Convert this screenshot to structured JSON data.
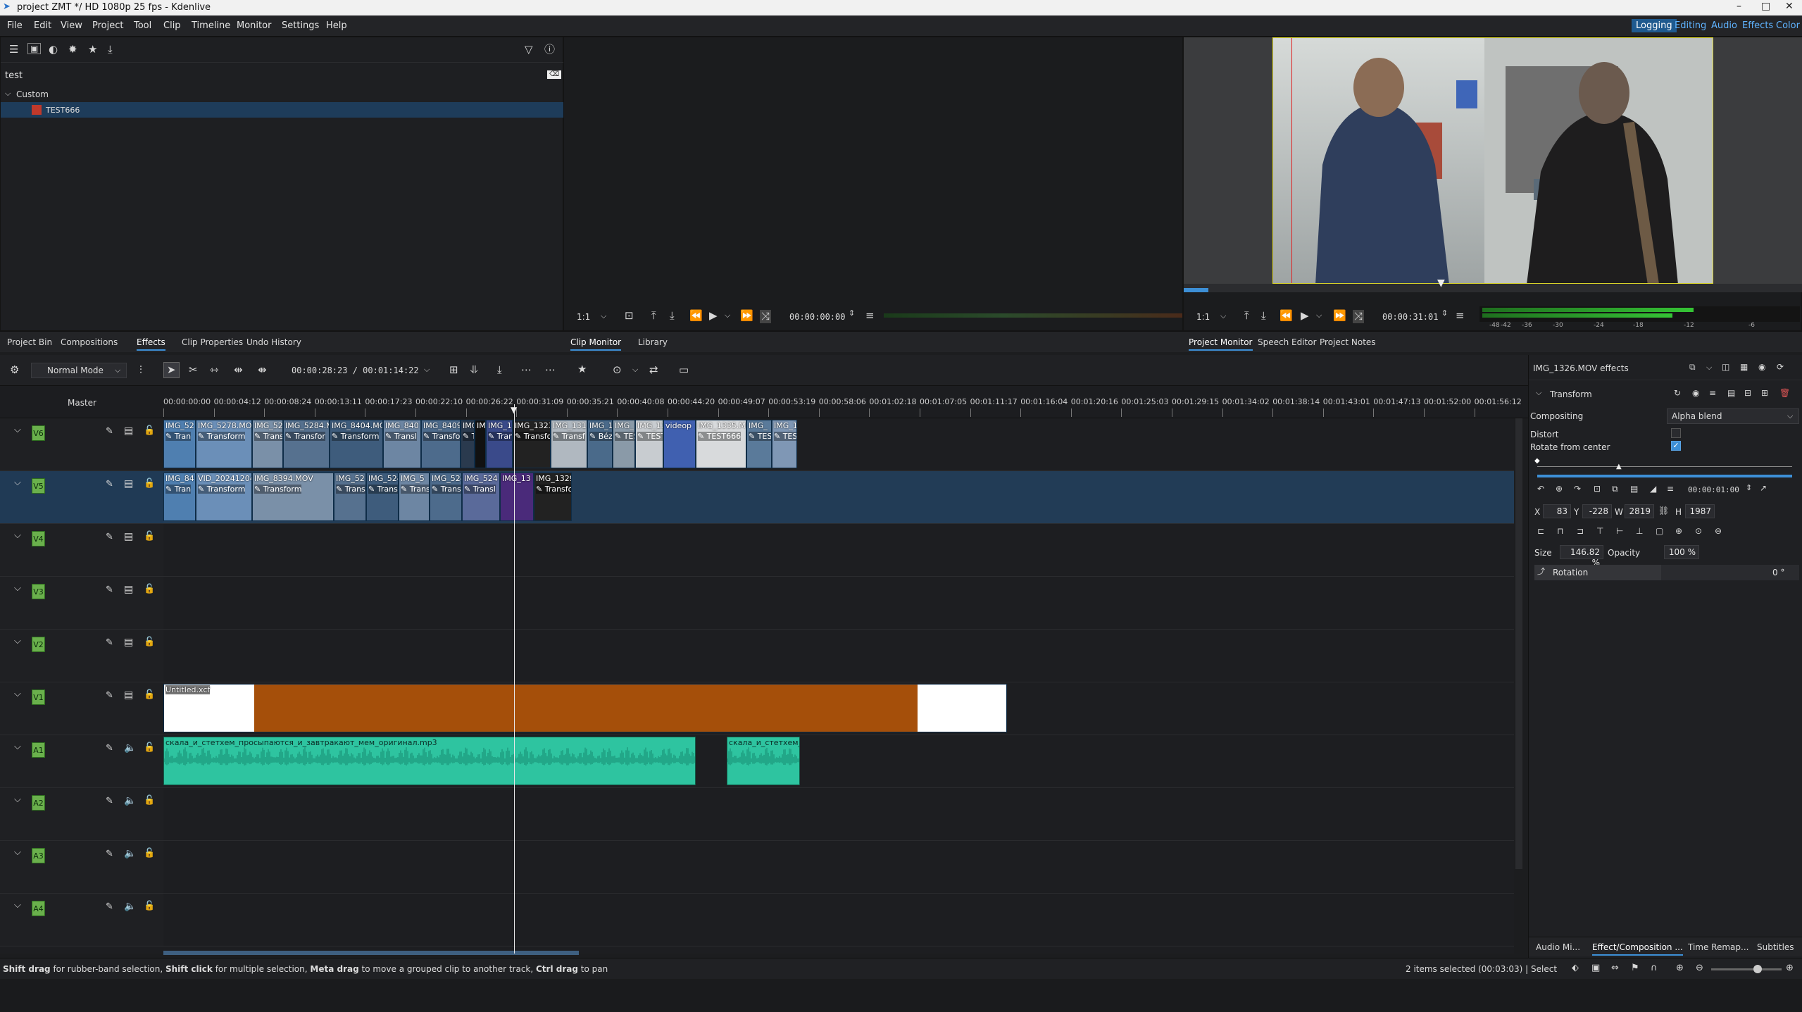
{
  "window": {
    "title": "project ZMT */ HD 1080p 25 fps - Kdenlive",
    "controls": [
      "–",
      "□",
      "✕"
    ]
  },
  "menu": [
    "File",
    "Edit",
    "View",
    "Project",
    "Tool",
    "Clip",
    "Timeline",
    "Monitor",
    "Settings",
    "Help"
  ],
  "workspaces": [
    "Logging",
    "Editing",
    "Audio",
    "Effects",
    "Color"
  ],
  "active_workspace": "Editing",
  "effects_panel": {
    "search_value": "test",
    "tree": [
      {
        "label": "Custom",
        "children": [
          {
            "label": "TEST666"
          }
        ]
      }
    ]
  },
  "left_tabs": [
    "Project Bin",
    "Compositions",
    "Effects",
    "Clip Properties",
    "Undo History"
  ],
  "left_active_tab": "Effects",
  "clip_monitor": {
    "zoom": "1:1",
    "timecode": "00:00:00:00",
    "tabs": [
      "Clip Monitor",
      "Library"
    ]
  },
  "project_monitor": {
    "zoom": "1:1",
    "timecode": "00:00:31:01",
    "tabs": [
      "Project Monitor",
      "Speech Editor",
      "Project Notes"
    ],
    "meter_labels": [
      "-48",
      "-42",
      "-36",
      "-30",
      "-24",
      "-18",
      "-12",
      "-6"
    ]
  },
  "timeline_toolbar": {
    "mode": "Normal Mode",
    "position": "00:00:28:23 / 00:01:14:22"
  },
  "timeline": {
    "master_label": "Master",
    "ruler": [
      "00:00:00:00",
      "00:00:04:12",
      "00:00:08:24",
      "00:00:13:11",
      "00:00:17:23",
      "00:00:22:10",
      "00:00:26:22",
      "00:00:31:09",
      "00:00:35:21",
      "00:00:40:08",
      "00:00:44:20",
      "00:00:49:07",
      "00:00:53:19",
      "00:00:58:06",
      "00:01:02:18",
      "00:01:07:05",
      "00:01:11:17",
      "00:01:16:04",
      "00:01:20:16",
      "00:01:25:03",
      "00:01:29:15",
      "00:01:34:02",
      "00:01:38:14",
      "00:01:43:01",
      "00:01:47:13",
      "00:01:52:00",
      "00:01:56:12"
    ],
    "tracks": [
      "V6",
      "V5",
      "V4",
      "V3",
      "V2",
      "V1",
      "A1",
      "A2",
      "A3",
      "A4"
    ],
    "v6_clips": [
      {
        "label": "IMG_52",
        "fx": "Tran"
      },
      {
        "label": "IMG_5278.MO",
        "fx": "Transform"
      },
      {
        "label": "IMG_52",
        "fx": "Trans"
      },
      {
        "label": "IMG_5284.M",
        "fx": "Transfor"
      },
      {
        "label": "IMG_8404.MC",
        "fx": "Transform"
      },
      {
        "label": "IMG_840",
        "fx": "Transl"
      },
      {
        "label": "IMG_8409",
        "fx": "Transfo"
      },
      {
        "label": "IMG",
        "fx": "Tra"
      },
      {
        "label": "IM",
        "fx": ""
      },
      {
        "label": "IMG_13",
        "fx": "Trans"
      },
      {
        "label": "IMG_1323",
        "fx": "Transfo"
      },
      {
        "label": "IMG_131",
        "fx": "Transf"
      },
      {
        "label": "IMG_1",
        "fx": "Bézier"
      },
      {
        "label": "IMG_",
        "fx": "TEST"
      },
      {
        "label": "IMG_13",
        "fx": "TEST"
      },
      {
        "label": "videop",
        "fx": ""
      },
      {
        "label": "IMG_1335.M",
        "fx": "TEST666"
      },
      {
        "label": "IMG_",
        "fx": "TEST6"
      },
      {
        "label": "IMG_13",
        "fx": "TEST"
      }
    ],
    "v5_clips": [
      {
        "label": "IMG_84",
        "fx": "Tran"
      },
      {
        "label": "VID_20241204",
        "fx": "Transform"
      },
      {
        "label": "IMG_8394.MOV",
        "fx": "Transform"
      },
      {
        "label": "IMG_52",
        "fx": "Trans"
      },
      {
        "label": "IMG_524",
        "fx": "Trans"
      },
      {
        "label": "IMG_5",
        "fx": "Trans"
      },
      {
        "label": "IMG_524",
        "fx": "Transf"
      },
      {
        "label": "IMG_524",
        "fx": "Transl"
      },
      {
        "label": "IMG_13",
        "fx": ""
      },
      {
        "label": "IMG_1329",
        "fx": "Transfo"
      }
    ],
    "v1_clip": "Untitled.kdenlivetitle",
    "v1_clip_label": "Untitled.xcf",
    "a1_clip_1": "скала_и_стетхем_просыпаются_и_завтракают_мем_оригинал.mp3",
    "a1_clip_2": "скала_и_стетхем_п"
  },
  "status": {
    "hint_parts": [
      {
        "b": "Shift drag"
      },
      {
        "t": " for rubber-band selection, "
      },
      {
        "b": "Shift click"
      },
      {
        "t": " for multiple selection, "
      },
      {
        "b": "Meta drag"
      },
      {
        "t": " to move a grouped clip to another track, "
      },
      {
        "b": "Ctrl drag"
      },
      {
        "t": " to pan"
      }
    ],
    "selection": "2 items selected (00:03:03) |",
    "tool": "Select"
  },
  "effect_stack": {
    "title": "IMG_1326.MOV effects",
    "effect_name": "Transform",
    "compositing_label": "Compositing",
    "compositing_value": "Alpha blend",
    "distort_label": "Distort",
    "rotate_center_label": "Rotate from center",
    "rotate_center_checked": true,
    "keyframe_time": "00:00:01:00",
    "x_label": "X",
    "x_value": "83",
    "y_label": "Y",
    "y_value": "-228",
    "w_label": "W",
    "w_value": "2819",
    "h_label": "H",
    "h_value": "1987",
    "size_label": "Size",
    "size_value": "146.82 %",
    "opacity_label": "Opacity",
    "opacity_value": "100 %",
    "rotation_label": "Rotation",
    "rotation_value": "0 °",
    "bottom_tabs": [
      "Audio Mi...",
      "Effect/Composition ...",
      "Time Remap...",
      "Subtitles"
    ],
    "active_bottom_tab": "Effect/Composition ..."
  },
  "colors": {
    "accent": "#3d8fd6",
    "video_clip": "#3c6e9e",
    "audio_clip": "#2ec4a0",
    "title_clip": "#a54f0a",
    "track_tag": "#6ab04c"
  }
}
